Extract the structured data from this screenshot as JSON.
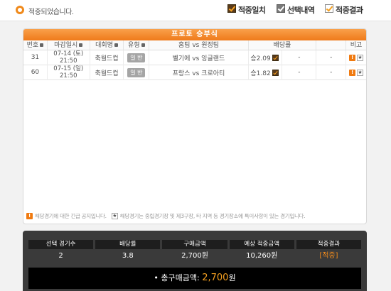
{
  "top": {
    "status": "적중되었습니다.",
    "filters": [
      {
        "label": "적중일치",
        "icon": "checkbox-checked-icon"
      },
      {
        "label": "선택내역",
        "icon": "checkbox-checked-icon"
      },
      {
        "label": "적중결과",
        "icon": "checkbox-checked-icon"
      }
    ]
  },
  "panel": {
    "title": "프로토 승부식",
    "columns": [
      "번호",
      "마감일시",
      "대회명",
      "유형",
      "홈팀 vs 원정팀",
      "배당률",
      "비고"
    ],
    "rows": [
      {
        "no": "31",
        "date": "07-14 (토)",
        "time": "21:50",
        "league": "축월드컵",
        "type": "일 반",
        "match": "벨기에 vs 잉글랜드",
        "odds1": "승2.09",
        "odds2": "-",
        "odds3": "-"
      },
      {
        "no": "60",
        "date": "07-15 (일)",
        "time": "21:50",
        "league": "축월드컵",
        "type": "일 반",
        "match": "프랑스 vs 크로아티",
        "odds1": "승1.82",
        "odds2": "-",
        "odds3": "-"
      }
    ],
    "notice1": "해당경기에 대한 긴급 공지입니다.",
    "notice2": "해당경기는 중립경기장 및 제3구장, 타 지역 등 경기장소에 특이사항이 있는 경기입니다."
  },
  "summary": {
    "headers": [
      "선택 경기수",
      "배당률",
      "구매금액",
      "예상 적중금액",
      "적중결과"
    ],
    "values": [
      "2",
      "3.8",
      "2,700원",
      "10,260원",
      "[적중]"
    ],
    "total_label": "• 총구매금액:",
    "total_amount": "2,700",
    "total_unit": "원"
  },
  "colors": {
    "accent": "#f08a1c",
    "header_bg": "#ef7a1a",
    "summary_bg": "#3a3a3a"
  }
}
